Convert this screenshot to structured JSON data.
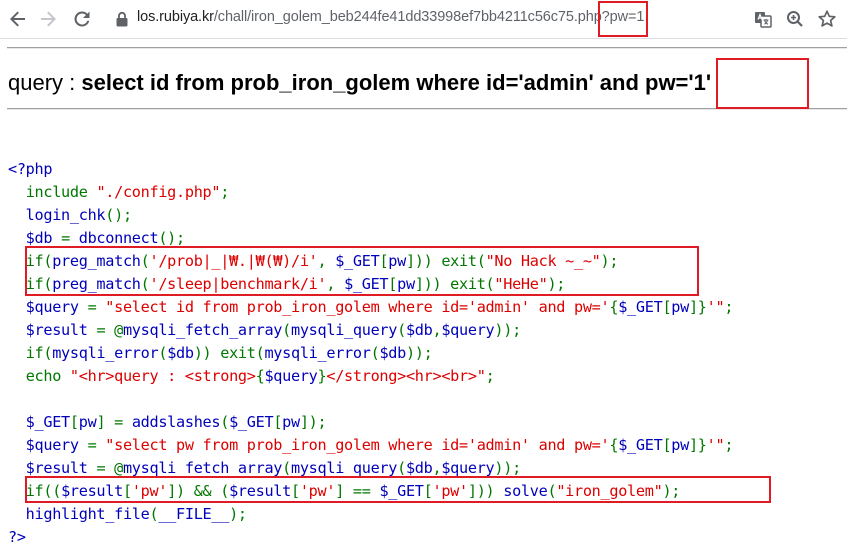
{
  "browser": {
    "url_host": "los.rubiya.kr",
    "url_path": "/chall/iron_golem_beb244fe41dd33998ef7bb4211c56c75.php?pw=1"
  },
  "page": {
    "query_prefix": "query : ",
    "query_sql": "select id from prob_iron_golem where id='admin' and pw='1'"
  },
  "source": {
    "lines": [
      [
        {
          "c": "d",
          "t": "<?php"
        }
      ],
      [
        {
          "c": "d",
          "t": "  "
        },
        {
          "c": "k",
          "t": "include "
        },
        {
          "c": "s",
          "t": "\"./config.php\""
        },
        {
          "c": "k",
          "t": ";"
        }
      ],
      [
        {
          "c": "d",
          "t": "  login_chk"
        },
        {
          "c": "k",
          "t": "();"
        }
      ],
      [
        {
          "c": "d",
          "t": "  $db "
        },
        {
          "c": "k",
          "t": "= "
        },
        {
          "c": "d",
          "t": "dbconnect"
        },
        {
          "c": "k",
          "t": "();"
        }
      ],
      [
        {
          "c": "d",
          "t": "  "
        },
        {
          "c": "k",
          "t": "if("
        },
        {
          "c": "d",
          "t": "preg_match"
        },
        {
          "c": "k",
          "t": "("
        },
        {
          "c": "s",
          "t": "'/prob|_|₩.|₩(₩)/i'"
        },
        {
          "c": "k",
          "t": ", "
        },
        {
          "c": "d",
          "t": "$_GET"
        },
        {
          "c": "k",
          "t": "["
        },
        {
          "c": "d",
          "t": "pw"
        },
        {
          "c": "k",
          "t": "])) exit("
        },
        {
          "c": "s",
          "t": "\"No Hack ~_~\""
        },
        {
          "c": "k",
          "t": ");"
        }
      ],
      [
        {
          "c": "d",
          "t": "  "
        },
        {
          "c": "k",
          "t": "if("
        },
        {
          "c": "d",
          "t": "preg_match"
        },
        {
          "c": "k",
          "t": "("
        },
        {
          "c": "s",
          "t": "'/sleep|benchmark/i'"
        },
        {
          "c": "k",
          "t": ", "
        },
        {
          "c": "d",
          "t": "$_GET"
        },
        {
          "c": "k",
          "t": "["
        },
        {
          "c": "d",
          "t": "pw"
        },
        {
          "c": "k",
          "t": "])) exit("
        },
        {
          "c": "s",
          "t": "\"HeHe\""
        },
        {
          "c": "k",
          "t": ");"
        }
      ],
      [
        {
          "c": "d",
          "t": "  $query "
        },
        {
          "c": "k",
          "t": "= "
        },
        {
          "c": "s",
          "t": "\"select id from prob_iron_golem where id='admin' and pw='"
        },
        {
          "c": "k",
          "t": "{"
        },
        {
          "c": "d",
          "t": "$_GET"
        },
        {
          "c": "k",
          "t": "["
        },
        {
          "c": "d",
          "t": "pw"
        },
        {
          "c": "k",
          "t": "]}"
        },
        {
          "c": "s",
          "t": "'\""
        },
        {
          "c": "k",
          "t": ";"
        }
      ],
      [
        {
          "c": "d",
          "t": "  $result "
        },
        {
          "c": "k",
          "t": "= @"
        },
        {
          "c": "d",
          "t": "mysqli_fetch_array"
        },
        {
          "c": "k",
          "t": "("
        },
        {
          "c": "d",
          "t": "mysqli_query"
        },
        {
          "c": "k",
          "t": "("
        },
        {
          "c": "d",
          "t": "$db"
        },
        {
          "c": "k",
          "t": ","
        },
        {
          "c": "d",
          "t": "$query"
        },
        {
          "c": "k",
          "t": "));"
        }
      ],
      [
        {
          "c": "d",
          "t": "  "
        },
        {
          "c": "k",
          "t": "if("
        },
        {
          "c": "d",
          "t": "mysqli_error"
        },
        {
          "c": "k",
          "t": "("
        },
        {
          "c": "d",
          "t": "$db"
        },
        {
          "c": "k",
          "t": ")) exit("
        },
        {
          "c": "d",
          "t": "mysqli_error"
        },
        {
          "c": "k",
          "t": "("
        },
        {
          "c": "d",
          "t": "$db"
        },
        {
          "c": "k",
          "t": "));"
        }
      ],
      [
        {
          "c": "d",
          "t": "  "
        },
        {
          "c": "k",
          "t": "echo "
        },
        {
          "c": "s",
          "t": "\"<hr>query : <strong>"
        },
        {
          "c": "k",
          "t": "{"
        },
        {
          "c": "d",
          "t": "$query"
        },
        {
          "c": "k",
          "t": "}"
        },
        {
          "c": "s",
          "t": "</strong><hr><br>\""
        },
        {
          "c": "k",
          "t": ";"
        }
      ],
      [
        {
          "c": "d",
          "t": " "
        }
      ],
      [
        {
          "c": "d",
          "t": "  $_GET"
        },
        {
          "c": "k",
          "t": "["
        },
        {
          "c": "d",
          "t": "pw"
        },
        {
          "c": "k",
          "t": "] = "
        },
        {
          "c": "d",
          "t": "addslashes"
        },
        {
          "c": "k",
          "t": "("
        },
        {
          "c": "d",
          "t": "$_GET"
        },
        {
          "c": "k",
          "t": "["
        },
        {
          "c": "d",
          "t": "pw"
        },
        {
          "c": "k",
          "t": "]);"
        }
      ],
      [
        {
          "c": "d",
          "t": "  $query "
        },
        {
          "c": "k",
          "t": "= "
        },
        {
          "c": "s",
          "t": "\"select pw from prob_iron_golem where id='admin' and pw='"
        },
        {
          "c": "k",
          "t": "{"
        },
        {
          "c": "d",
          "t": "$_GET"
        },
        {
          "c": "k",
          "t": "["
        },
        {
          "c": "d",
          "t": "pw"
        },
        {
          "c": "k",
          "t": "]}"
        },
        {
          "c": "s",
          "t": "'\""
        },
        {
          "c": "k",
          "t": ";"
        }
      ],
      [
        {
          "c": "d",
          "t": "  $result "
        },
        {
          "c": "k",
          "t": "= @"
        },
        {
          "c": "d",
          "t": "mysqli_fetch_array"
        },
        {
          "c": "k",
          "t": "("
        },
        {
          "c": "d",
          "t": "mysqli_query"
        },
        {
          "c": "k",
          "t": "("
        },
        {
          "c": "d",
          "t": "$db"
        },
        {
          "c": "k",
          "t": ","
        },
        {
          "c": "d",
          "t": "$query"
        },
        {
          "c": "k",
          "t": "));"
        }
      ],
      [
        {
          "c": "d",
          "t": "  "
        },
        {
          "c": "k",
          "t": "if(("
        },
        {
          "c": "d",
          "t": "$result"
        },
        {
          "c": "k",
          "t": "["
        },
        {
          "c": "s",
          "t": "'pw'"
        },
        {
          "c": "k",
          "t": "]) && ("
        },
        {
          "c": "d",
          "t": "$result"
        },
        {
          "c": "k",
          "t": "["
        },
        {
          "c": "s",
          "t": "'pw'"
        },
        {
          "c": "k",
          "t": "] == "
        },
        {
          "c": "d",
          "t": "$_GET"
        },
        {
          "c": "k",
          "t": "["
        },
        {
          "c": "s",
          "t": "'pw'"
        },
        {
          "c": "k",
          "t": "])) "
        },
        {
          "c": "d",
          "t": "solve"
        },
        {
          "c": "k",
          "t": "("
        },
        {
          "c": "s",
          "t": "\"iron_golem\""
        },
        {
          "c": "k",
          "t": ");"
        }
      ],
      [
        {
          "c": "d",
          "t": "  highlight_file"
        },
        {
          "c": "k",
          "t": "("
        },
        {
          "c": "d",
          "t": "__FILE__"
        },
        {
          "c": "k",
          "t": ");"
        }
      ],
      [
        {
          "c": "d",
          "t": "?>"
        }
      ]
    ]
  }
}
